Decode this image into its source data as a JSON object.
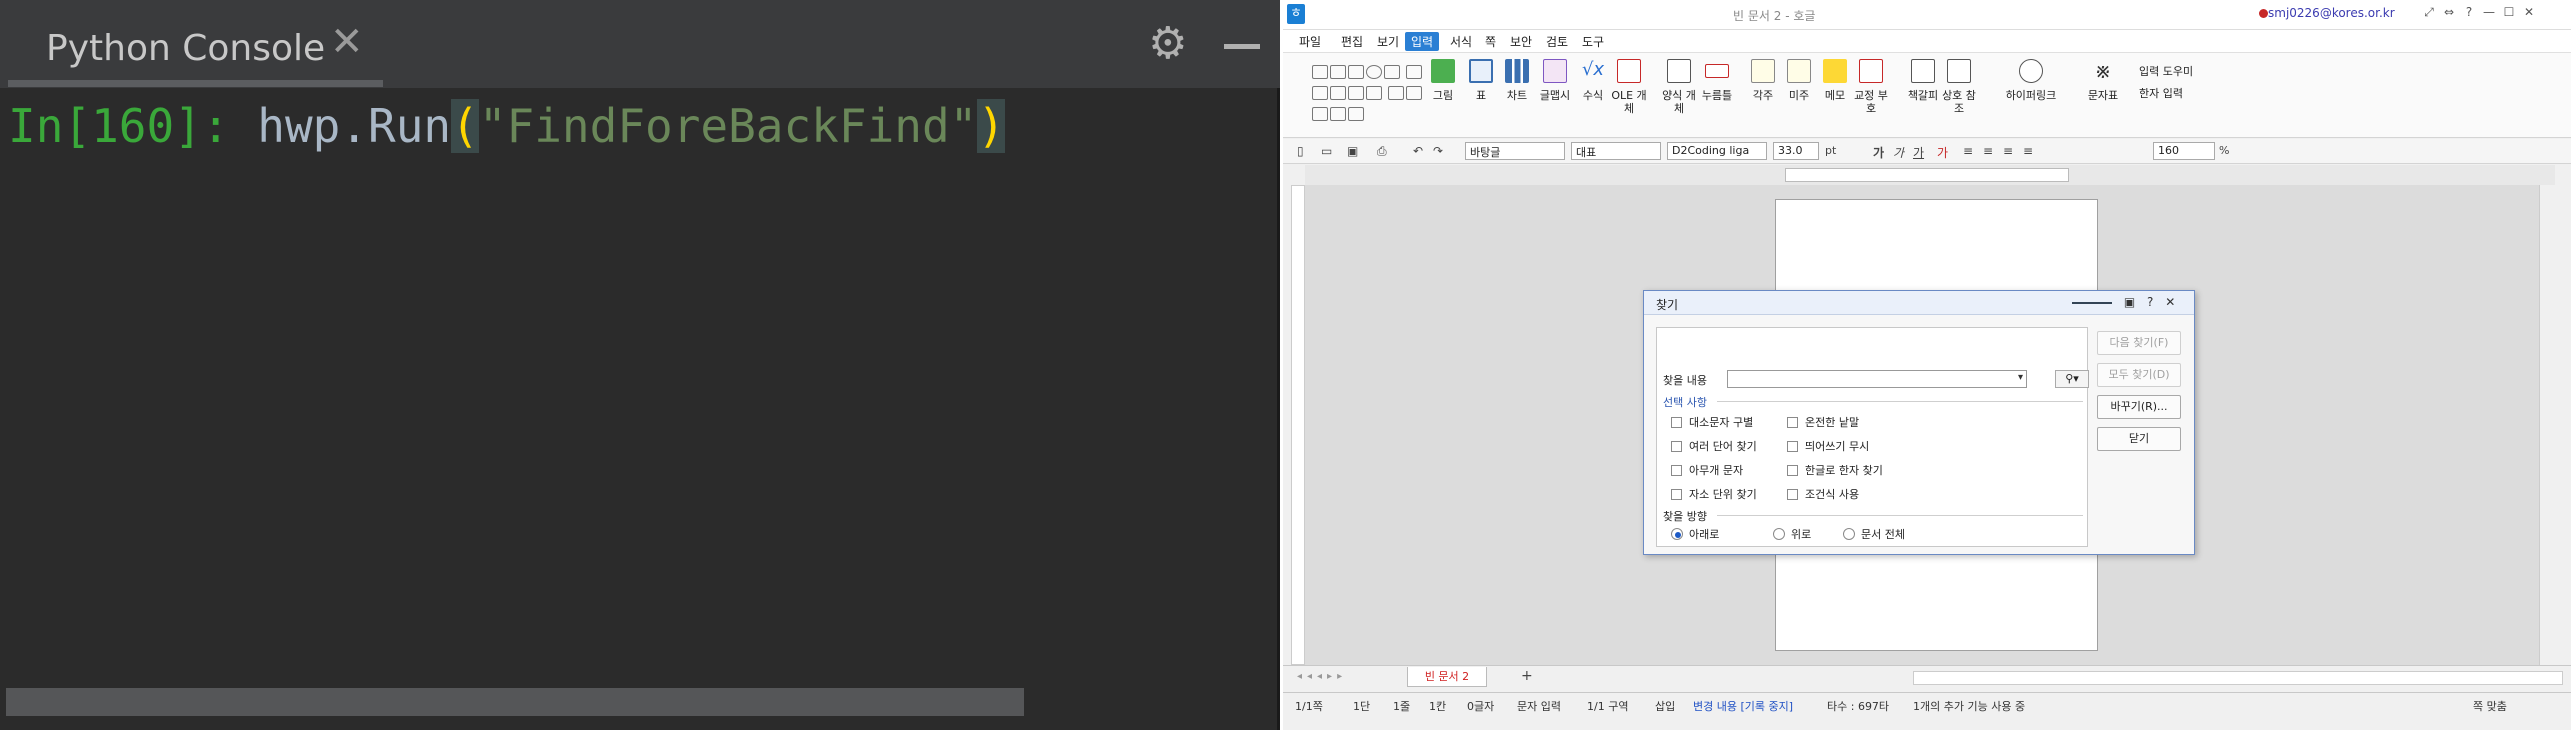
{
  "console": {
    "tab_title": "Python Console",
    "prompt": "In[160]:",
    "ident": "hwp.Run",
    "paren_open": "(",
    "string": "\"FindForeBackFind\"",
    "paren_close": ")"
  },
  "hwp": {
    "window_title": "빈 문서 2 - 호글",
    "user_email": "smj0226@kores.or.kr",
    "win_controls": [
      "⤢",
      "⇔",
      "?",
      "—",
      "☐",
      "✕"
    ],
    "menu": [
      "파일",
      "편집",
      "보기",
      "입력",
      "서식",
      "쪽",
      "보안",
      "검토",
      "도구"
    ],
    "active_menu": "입력",
    "ribbon": [
      "그림",
      "표",
      "차트",
      "글맵시",
      "수식",
      "OLE 개체",
      "양식 개체",
      "누름틀",
      "각주",
      "미주",
      "메모",
      "교정 부호",
      "책갈피",
      "상호 참조",
      "하이퍼링크",
      "문자표"
    ],
    "ribbon_side": [
      "입력 도우미",
      "한자 입력"
    ],
    "format": {
      "style": "바탕글",
      "para": "대표",
      "font": "D2Coding liga",
      "size": "33.0",
      "size_unit": "pt",
      "zoom": "160",
      "zoom_unit": "%"
    },
    "doc_tab": "빈 문서 2",
    "status": {
      "page": "1/1쪽",
      "col": "1단",
      "line": "1줄",
      "cell": "1칸",
      "chars": "0글자",
      "mode": "문자 입력",
      "section": "1/1 구역",
      "insert": "삽입",
      "track": "변경 내용 [기록 중지]",
      "typing": "타수 : 697타",
      "extra": "1개의 추가 기능 사용 중",
      "fit": "쪽 맞춤"
    },
    "dialog": {
      "title": "찾기",
      "find_label": "찾을 내용",
      "options_heading": "선택 사항",
      "options": [
        "대소문자 구별",
        "온전한 낱말",
        "여러 단어 찾기",
        "띄어쓰기 무시",
        "아무개 문자",
        "한글로 한자 찾기",
        "자소 단위 찾기",
        "조건식 사용"
      ],
      "direction_heading": "찾을 방향",
      "directions": [
        "아래로",
        "위로",
        "문서 전체"
      ],
      "buttons": [
        "다음 찾기(F)",
        "모두 찾기(D)",
        "바꾸기(R)...",
        "닫기"
      ]
    }
  }
}
